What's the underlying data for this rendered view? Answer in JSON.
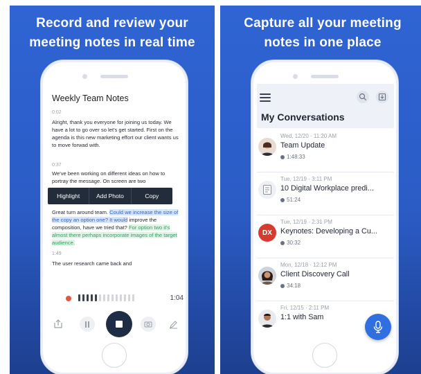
{
  "left": {
    "headline_line1": "Record and review your",
    "headline_line2": "meeting notes in real time",
    "notes": {
      "title": "Weekly Team Notes",
      "segments": [
        {
          "time": "0:02",
          "text": "Alright, thank you everyone for joining us today. We have a lot to go over so let's get started. First on the agenda is this new marketing effort our client wants us to move forwad with."
        },
        {
          "time": "0:37",
          "text": "We've been working on different ideas on how to portray the message. On screen are two"
        },
        {
          "time": "1:49",
          "text": "The user research came back and"
        }
      ],
      "selection_para": {
        "plain": "Great turn around team.",
        "selected": "Could we increase the size of the copy an option one? It would",
        "tail": "improve the composition, have we tried that?",
        "highlighted": "For option two it's almost there perhaps incorporate images of the target audience."
      },
      "context_menu": [
        "Highlight",
        "Add Photo",
        "Copy"
      ]
    },
    "player": {
      "elapsed": "1:04",
      "waveform_played_fraction": 0.36
    }
  },
  "right": {
    "headline_line1": "Capture all your meeting",
    "headline_line2": "notes in one place",
    "page_title": "My Conversations",
    "conversations": [
      {
        "date": "Wed, 12/20 · 11:20 AM",
        "title": "Team Update",
        "duration": "1:48:33",
        "avatar": "person-woman-icon"
      },
      {
        "date": "Tue, 12/19 · 3:11 PM",
        "title": "10 Digital Workplace predi...",
        "duration": "51:24",
        "avatar": "document-icon"
      },
      {
        "date": "Tue, 12/19 · 2:31 PM",
        "title": "Keynotes: Developing a Cu...",
        "duration": "30:32",
        "avatar": "dx-logo"
      },
      {
        "date": "Mon, 12/18 · 12:12 PM",
        "title": "Client Discovery Call",
        "duration": "34:18",
        "avatar": "person-woman-icon"
      },
      {
        "date": "Fri, 12/15 · 2:11 PM",
        "title": "1:1 with Sam",
        "duration": "",
        "avatar": "person-man-icon"
      }
    ],
    "logo_text": "DX"
  },
  "colors": {
    "accent": "#2f6fe0",
    "panel_blue": "#2f64d3",
    "record": "#e8563f",
    "highlight_blue": "#d5e4ff",
    "highlight_green": "#dff3e6"
  }
}
